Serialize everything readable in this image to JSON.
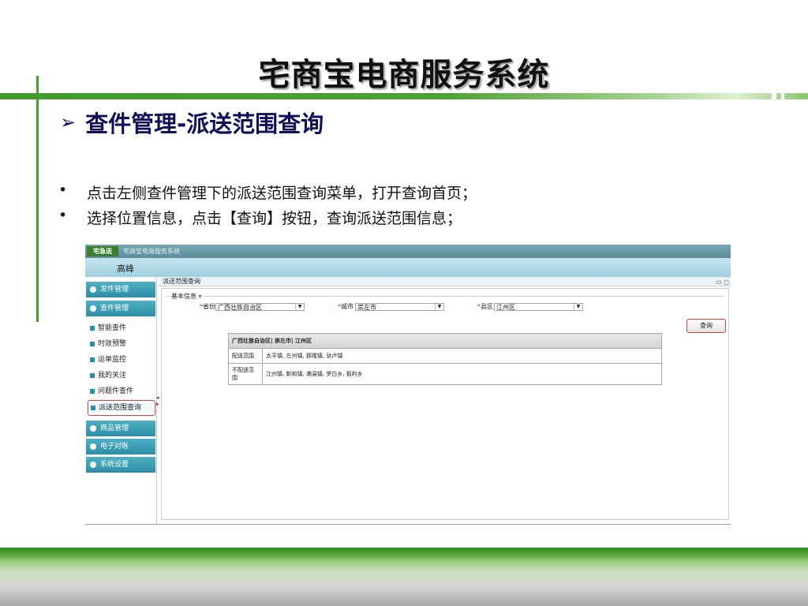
{
  "slide": {
    "title": "宅商宝电商服务系统",
    "subtitle": "查件管理-派送范围查询",
    "bullets": [
      "点击左侧查件管理下的派送范围查询菜单，打开查询首页；",
      "选择位置信息，点击【查询】按钮，查询派送范围信息；"
    ]
  },
  "app": {
    "logo_text": "宅急送",
    "title": "宅商宝电商服务系统",
    "user_name": "高峰",
    "menu": {
      "send": "发件管理",
      "query": "查件管理",
      "query_items": [
        "智能查件",
        "时效预警",
        "运单监控",
        "我的关注",
        "问题件查件",
        "派送范围查询"
      ],
      "goods": "商品管理",
      "bill": "电子对账",
      "settings": "系统设置"
    },
    "tab_title": "派送范围查询",
    "section_label": "基本信息",
    "fields": {
      "province_label": "省份",
      "province_value": "广西壮族自治区",
      "city_label": "城市",
      "city_value": "崇左市",
      "county_label": "县区",
      "county_value": "江州区"
    },
    "query_button": "查询",
    "result": {
      "header": "广西壮族自治区| 崇左市| 江州区",
      "rows": [
        {
          "key": "配送范围",
          "value": "太平镇, 左州镇, 那隆镇, 驮卢镇"
        },
        {
          "key": "不配送范围",
          "value": "江州镇, 新和镇, 濑湍镇, 罗白乡, 板利乡"
        }
      ]
    }
  },
  "colors": {
    "accent_green": "#4a9a35",
    "title_navy": "#10105a",
    "menu_teal": "#2c8ea6",
    "highlight_red": "#d94040"
  }
}
